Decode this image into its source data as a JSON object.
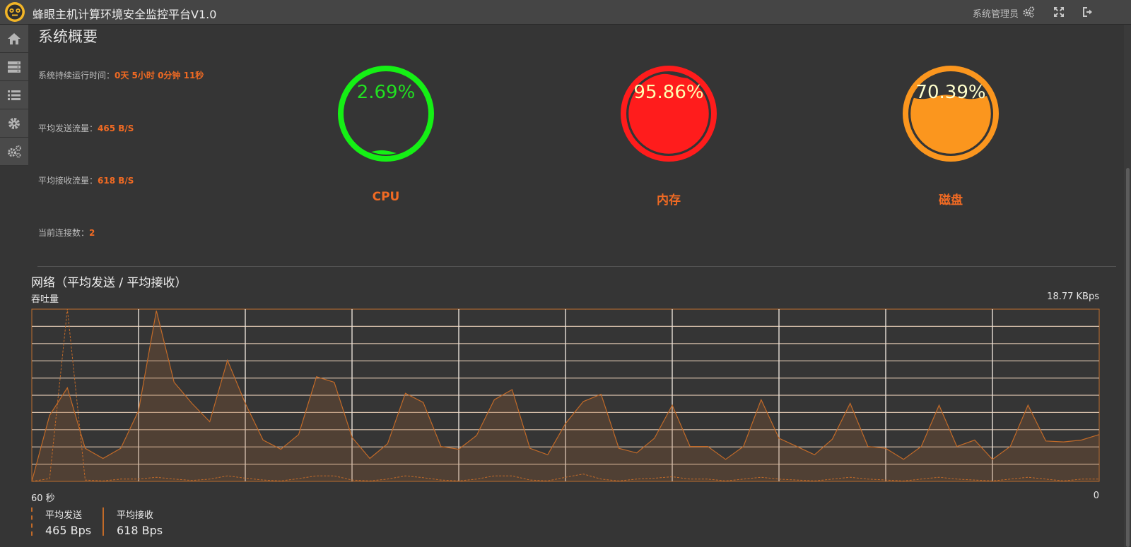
{
  "header": {
    "title": "蜂眼主机计算环境安全监控平台V1.0",
    "user": "系统管理员",
    "icons": [
      "settings-icon",
      "fullscreen-icon",
      "logout-icon"
    ]
  },
  "sidebar": {
    "items": [
      {
        "icon": "home-icon"
      },
      {
        "icon": "server-icon"
      },
      {
        "icon": "list-icon"
      },
      {
        "icon": "gear-icon"
      },
      {
        "icon": "gears-icon"
      }
    ]
  },
  "overview": {
    "title": "系统概要",
    "uptime_label": "系统持续运行时间：",
    "uptime_value": "0天 5小时 0分钟 11秒",
    "avg_send_label": "平均发送流量：",
    "avg_send_value": "465 B/S",
    "avg_recv_label": "平均接收流量：",
    "avg_recv_value": "618 B/S",
    "connections_label": "当前连接数：",
    "connections_value": "2"
  },
  "gauges": [
    {
      "label": "CPU",
      "percent_text": "2.69%",
      "value": 0.0269,
      "color": "#15f015",
      "text_color": "#21e021"
    },
    {
      "label": "内存",
      "percent_text": "95.86%",
      "value": 0.9586,
      "color": "#ff1c1c",
      "text_color": "#ffffb0"
    },
    {
      "label": "磁盘",
      "percent_text": "70.39%",
      "value": 0.7039,
      "color": "#fb961e",
      "text_color": "#ffffcc"
    }
  ],
  "network": {
    "title": "网络（平均发送 / 平均接收）",
    "subtitle": "吞吐量",
    "max_label": "18.77 KBps",
    "x_left_label": "60 秒",
    "x_right_label": "0",
    "legend": [
      {
        "name": "平均发送",
        "value": "465 Bps"
      },
      {
        "name": "平均接收",
        "value": "618 Bps"
      }
    ]
  },
  "chart_data": {
    "type": "area",
    "title": "网络（平均发送 / 平均接收）",
    "ylabel": "吞吐量",
    "ylim": [
      0,
      18.77
    ],
    "y_unit": "KBps",
    "x_range_seconds": [
      60,
      0
    ],
    "series": [
      {
        "name": "平均接收",
        "style": "solid-area",
        "values": [
          0,
          7.2,
          10.2,
          3.6,
          2.5,
          3.6,
          7.7,
          18.6,
          10.8,
          8.5,
          6.5,
          13.2,
          8.5,
          4.5,
          3.5,
          5.1,
          11.4,
          10.8,
          4.8,
          2.5,
          4.1,
          9.6,
          8.6,
          3.8,
          3.5,
          5.0,
          8.9,
          10.0,
          3.6,
          2.9,
          6.3,
          8.7,
          9.5,
          3.6,
          3.1,
          4.7,
          8.3,
          3.8,
          3.8,
          2.4,
          3.8,
          8.9,
          4.7,
          3.8,
          2.9,
          4.6,
          8.5,
          3.8,
          3.6,
          2.4,
          3.8,
          8.3,
          3.8,
          4.5,
          2.4,
          3.8,
          8.3,
          4.4,
          4.3,
          4.5,
          5.1
        ]
      },
      {
        "name": "平均发送",
        "style": "dashed",
        "values": [
          0,
          0.3,
          18.77,
          0.15,
          0.05,
          0.25,
          0.25,
          0.45,
          0.25,
          0.1,
          0.25,
          0.6,
          0.35,
          0.15,
          0.05,
          0.3,
          0.6,
          0.6,
          0.15,
          0.05,
          0.25,
          0.6,
          0.4,
          0.15,
          0.05,
          0.25,
          0.6,
          0.6,
          0.15,
          0.05,
          0.45,
          0.8,
          0.25,
          0.05,
          0.25,
          0.35,
          0.5,
          0.25,
          0.25,
          0.05,
          0.25,
          0.45,
          0.25,
          0.15,
          0.05,
          0.25,
          0.45,
          0.25,
          0.15,
          0.05,
          0.25,
          0.45,
          0.25,
          0.15,
          0.05,
          0.25,
          0.45,
          0.25,
          0.05,
          0.25,
          0.25
        ]
      }
    ],
    "grid": true,
    "grid_rows": 10,
    "grid_cols": 10
  }
}
